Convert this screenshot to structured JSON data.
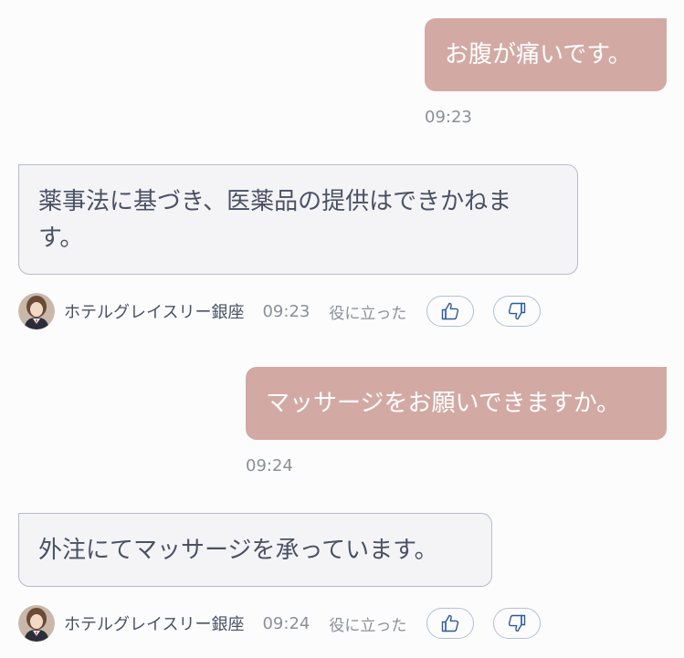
{
  "messages": [
    {
      "role": "user",
      "text": "お腹が痛いです。",
      "time": "09:23"
    },
    {
      "role": "bot",
      "lines": [
        "薬事法に基づき、医薬品の提供はできかねま",
        "す。"
      ],
      "sender": "ホテルグレイスリー銀座",
      "time": "09:23",
      "helpful_label": "役に立った"
    },
    {
      "role": "user",
      "text": "マッサージをお願いできますか。",
      "time": "09:24"
    },
    {
      "role": "bot",
      "lines": [
        "外注にてマッサージを承っています。"
      ],
      "sender": "ホテルグレイスリー銀座",
      "time": "09:24",
      "helpful_label": "役に立った"
    }
  ],
  "icons": {
    "avatar": "hotel-staff-avatar",
    "thumbs_up": "thumbs-up-icon",
    "thumbs_down": "thumbs-down-icon"
  },
  "colors": {
    "user_bubble": "#d3a9a4",
    "bot_bubble_bg": "#f4f4f6",
    "bot_bubble_border": "#b7bccb",
    "vote_border": "#b2c0d6",
    "icon_blue": "#2c5a9a"
  }
}
